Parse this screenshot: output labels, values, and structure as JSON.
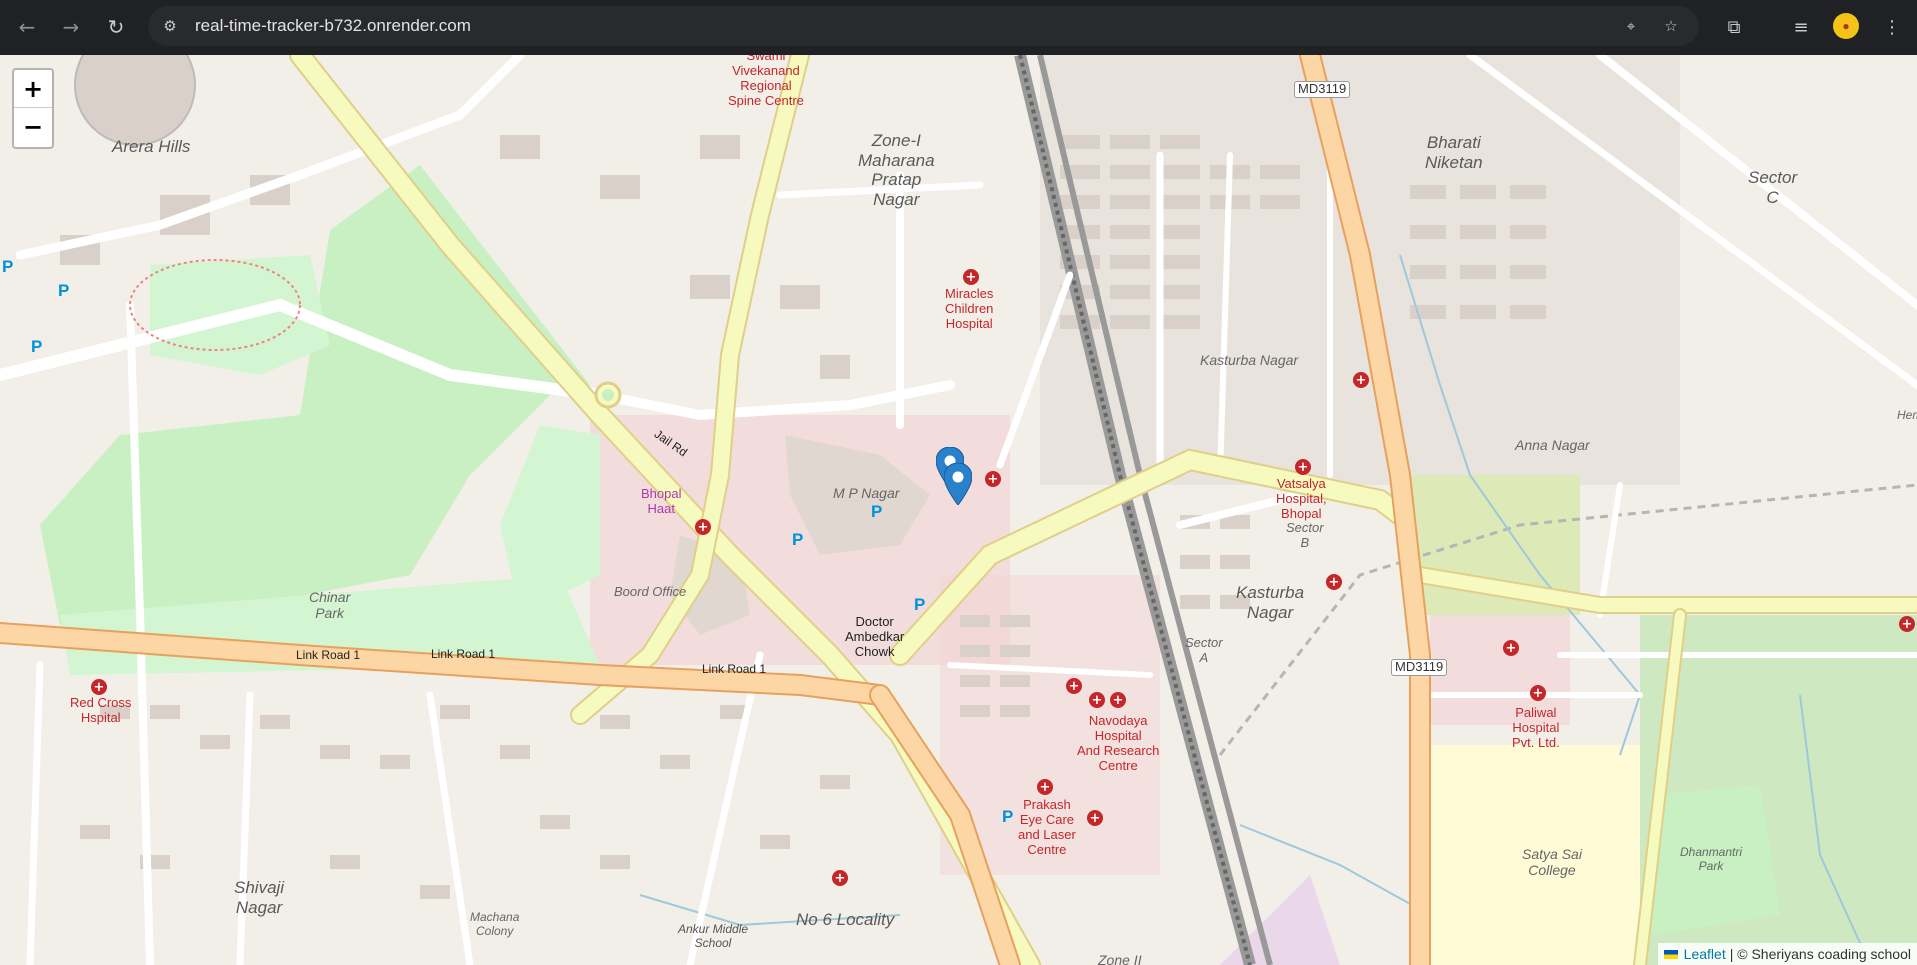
{
  "browser": {
    "url": "real-time-tracker-b732.onrender.com",
    "back_icon": "arrow-left-icon",
    "forward_icon": "arrow-right-icon",
    "reload_icon": "reload-icon",
    "site_info_icon": "tune-icon",
    "location_icon": "location-pin-icon",
    "bookmark_icon": "star-icon",
    "extensions_icon": "puzzle-icon",
    "media_icon": "media-icon",
    "menu_icon": "kebab-menu-icon"
  },
  "map": {
    "zoom_in": "+",
    "zoom_out": "−",
    "attribution": {
      "leaflet": "Leaflet",
      "rest": "| © Sheriyans coading school"
    },
    "labels": {
      "arera_hills": "Arera Hills",
      "swami_1": "Swami",
      "swami_2": "Vivekanand",
      "swami_3": "Regional",
      "swami_4": "Spine Centre",
      "zone1_1": "Zone-I",
      "zone1_2": "Maharana",
      "zone1_3": "Pratap",
      "zone1_4": "Nagar",
      "miracles_1": "Miracles",
      "miracles_2": "Children",
      "miracles_3": "Hospital",
      "bharati_1": "Bharati",
      "bharati_2": "Niketan",
      "sector_c_1": "Sector",
      "sector_c_2": "C",
      "kasturba_nagar_top": "Kasturba Nagar",
      "anna_nagar": "Anna Nagar",
      "vatsalya_1": "Vatsalya",
      "vatsalya_2": "Hospital,",
      "vatsalya_3": "Bhopal",
      "sector_b_1": "Sector",
      "sector_b_2": "B",
      "kasturba_2_1": "Kasturba",
      "kasturba_2_2": "Nagar",
      "sector_a_1": "Sector",
      "sector_a_2": "A",
      "md3119_top": "MD3119",
      "md3119_mid": "MD3119",
      "jail_rd": "Jail Rd",
      "bhopal_haat_1": "Bhopal",
      "bhopal_haat_2": "Haat",
      "mp_nagar": "M P Nagar",
      "board_office": "Boord Office",
      "chinar_1": "Chinar",
      "chinar_2": "Park",
      "link1": "Link Road 1",
      "link2": "Link Road 1",
      "link3": "Link Road 1",
      "ambedkar_1": "Doctor",
      "ambedkar_2": "Ambedkar",
      "ambedkar_3": "Chowk",
      "redcross_1": "Red Cross",
      "redcross_2": "Hspital",
      "navodaya_1": "Navodaya",
      "navodaya_2": "Hospital",
      "navodaya_3": "And Research",
      "navodaya_4": "Centre",
      "paliwal_1": "Paliwal",
      "paliwal_2": "Hospital",
      "paliwal_3": "Pvt. Ltd.",
      "prakash_1": "Prakash",
      "prakash_2": "Eye Care",
      "prakash_3": "and Laser",
      "prakash_4": "Centre",
      "satya_1": "Satya Sai",
      "satya_2": "College",
      "dhanmantri_1": "Dhanmantri",
      "dhanmantri_2": "Park",
      "shivaji_1": "Shivaji",
      "shivaji_2": "Nagar",
      "machana_1": "Machana",
      "machana_2": "Colony",
      "ankur_1": "Ankur Middle",
      "ankur_2": "School",
      "no6": "No 6 Locality",
      "zone2": "Zone II",
      "hem": "Hem"
    },
    "markers_count": 2
  }
}
